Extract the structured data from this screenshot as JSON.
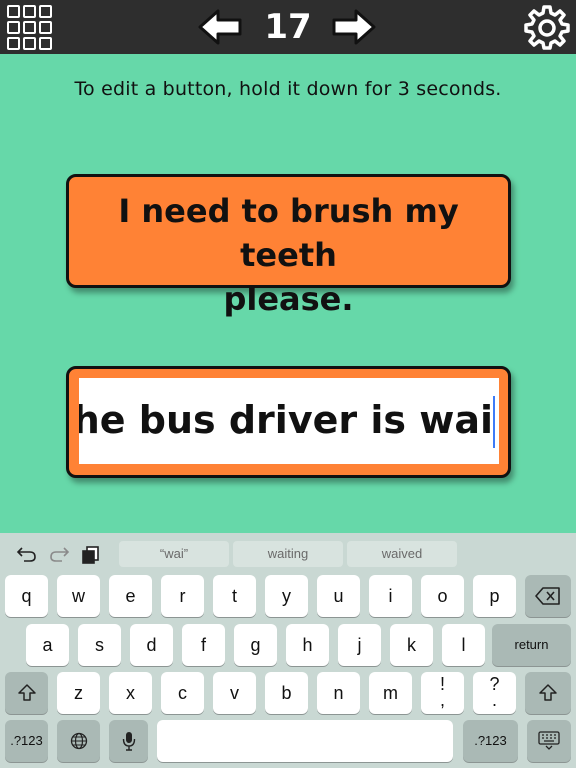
{
  "topbar": {
    "page_number": "17",
    "icons": {
      "menu": "grid-menu-icon",
      "previous": "arrow-left-icon",
      "next": "arrow-right-icon",
      "settings": "gear-icon"
    }
  },
  "instruction": "To edit a button, hold it down for 3 seconds.",
  "phrases": [
    {
      "line1": "I need to brush my teeth",
      "line2": "please."
    },
    {
      "edit_value": "he bus driver is wai"
    }
  ],
  "keyboard": {
    "suggestions": [
      "“wai”",
      "waiting",
      "waived"
    ],
    "row1": [
      "q",
      "w",
      "e",
      "r",
      "t",
      "y",
      "u",
      "i",
      "o",
      "p"
    ],
    "row2": [
      "a",
      "s",
      "d",
      "f",
      "g",
      "h",
      "j",
      "k",
      "l"
    ],
    "row3": [
      "z",
      "x",
      "c",
      "v",
      "b",
      "n",
      "m"
    ],
    "return_label": "return",
    "numbers_label_left": ".?123",
    "numbers_label_right": ".?123",
    "punct1_top": "!",
    "punct1_bottom": ",",
    "punct2_top": "?",
    "punct2_bottom": ".",
    "colors": {
      "background": "#c9d8d3",
      "key": "#ffffff",
      "function_key": "#aab9b5"
    }
  },
  "colors": {
    "page_background": "#66d8a9",
    "topbar": "#2e2e2e",
    "phrase_button": "#ff8235",
    "caret": "#3d7bf7"
  }
}
